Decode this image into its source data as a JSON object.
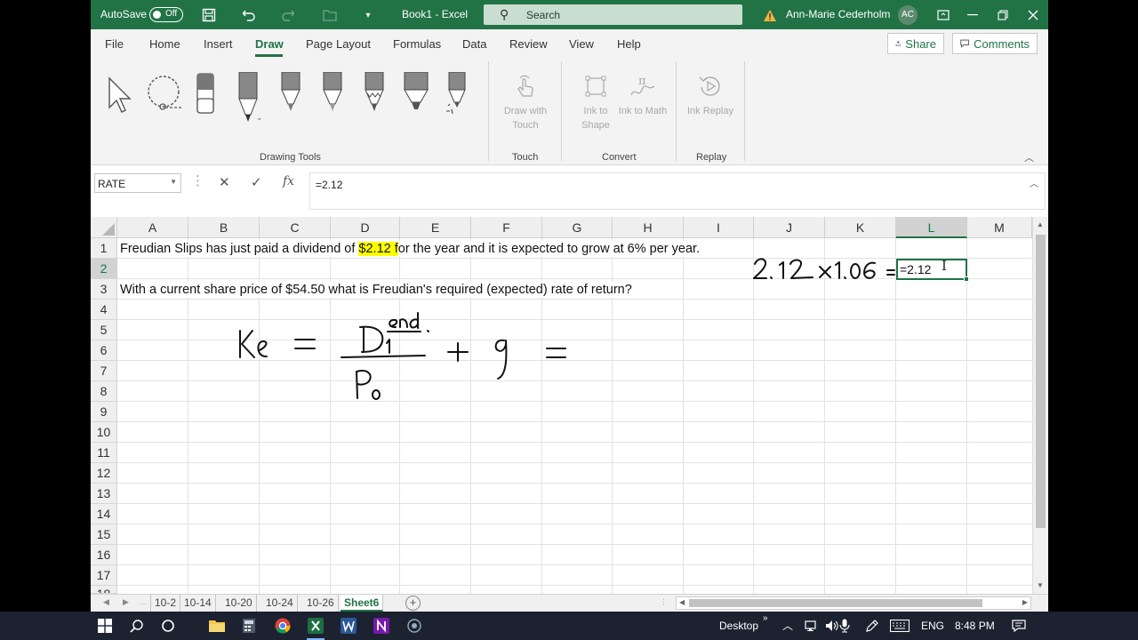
{
  "titlebar": {
    "autosave_label": "AutoSave",
    "autosave_state": "Off",
    "doc_title": "Book1  -  Excel",
    "search_placeholder": "Search",
    "user_name": "Ann-Marie Cederholm",
    "user_initials": "AC"
  },
  "menu": {
    "tabs": [
      "File",
      "Home",
      "Insert",
      "Draw",
      "Page Layout",
      "Formulas",
      "Data",
      "Review",
      "View",
      "Help"
    ],
    "active": "Draw",
    "share_label": "Share",
    "comments_label": "Comments"
  },
  "ribbon": {
    "groups": {
      "drawing_tools": "Drawing Tools",
      "touch": "Touch",
      "convert": "Convert",
      "replay": "Replay"
    },
    "buttons": {
      "draw_with_touch": "Draw with Touch",
      "ink_to_shape": "Ink to Shape",
      "ink_to_math": "Ink to Math",
      "ink_replay": "Ink Replay"
    }
  },
  "formula_bar": {
    "name_box": "RATE",
    "formula": "=2.12"
  },
  "grid": {
    "columns": [
      "A",
      "B",
      "C",
      "D",
      "E",
      "F",
      "G",
      "H",
      "I",
      "J",
      "K",
      "L",
      "M"
    ],
    "selected_column": "L",
    "rows": [
      "1",
      "2",
      "3",
      "4",
      "5",
      "6",
      "7",
      "8",
      "9",
      "10",
      "11",
      "12",
      "13",
      "14",
      "15",
      "16",
      "17",
      "18"
    ],
    "selected_row": "2",
    "cells": {
      "A1_pre": "Freudian Slips has just paid a dividend of ",
      "A1_highlight": "$2.12 f",
      "A1_post": "or the year and it is expected to grow at 6% per year.",
      "A3": "With a current share price of $54.50 what is Freudian's required (expected) rate of return?",
      "L2_edit": "=2.12"
    },
    "ink_annotation": {
      "row2": "2.12 × 1.06 =",
      "formula_left": "Ke =",
      "numerator": "D1",
      "numerator_note": "end",
      "denominator": "P0",
      "formula_right": "+ g ="
    }
  },
  "sheets": {
    "tabs": [
      "10-2",
      "10-14",
      "10-20",
      "10-24",
      "10-26",
      "Sheet6"
    ],
    "active": "Sheet6"
  },
  "taskbar": {
    "desktop_label": "Desktop",
    "lang": "ENG",
    "time": "8:48 PM"
  },
  "colors": {
    "excel_green": "#217346",
    "highlight": "#ffff00"
  }
}
